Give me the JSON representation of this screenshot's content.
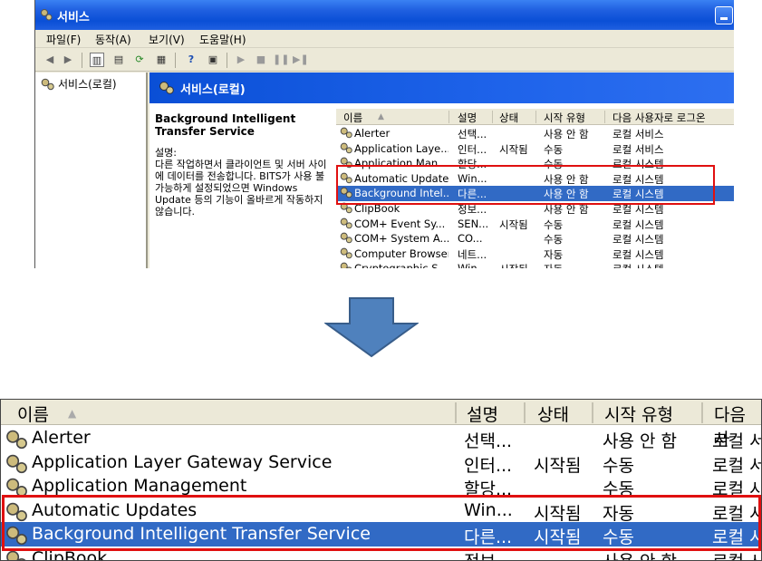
{
  "window": {
    "title": "서비스"
  },
  "menu": [
    "파일(F)",
    "동작(A)",
    "보기(V)",
    "도움말(H)"
  ],
  "tree": {
    "root_label": "서비스(로컬)"
  },
  "banner": {
    "title": "서비스(로컬)"
  },
  "description": {
    "service_name": "Background Intelligent Transfer Service",
    "label": "설명:",
    "text": "다른 작업하면서 클라이언트 및 서버 사이에 데이터를 전송합니다. BITS가 사용 불가능하게 설정되었으면 Windows Update 등의 기능이 올바르게 작동하지 않습니다."
  },
  "list": {
    "columns": [
      "이름",
      "설명",
      "상태",
      "시작 유형",
      "다음 사용자로 로그온"
    ],
    "rows": [
      {
        "name": "Alerter",
        "desc": "선택...",
        "status": "",
        "startup": "사용 안 함",
        "logon": "로컬 서비스"
      },
      {
        "name": "Application Laye...",
        "desc": "인터...",
        "status": "시작됨",
        "startup": "수동",
        "logon": "로컬 서비스"
      },
      {
        "name": "Application Man...",
        "desc": "할당...",
        "status": "",
        "startup": "수동",
        "logon": "로컬 시스템"
      },
      {
        "name": "Automatic Updates",
        "desc": "Win...",
        "status": "",
        "startup": "사용 안 함",
        "logon": "로컬 시스템"
      },
      {
        "name": "Background Intel...",
        "desc": "다른...",
        "status": "",
        "startup": "사용 안 함",
        "logon": "로컬 시스템"
      },
      {
        "name": "ClipBook",
        "desc": "정보...",
        "status": "",
        "startup": "사용 안 함",
        "logon": "로컬 시스템"
      },
      {
        "name": "COM+ Event Sy...",
        "desc": "SEN...",
        "status": "시작됨",
        "startup": "수동",
        "logon": "로컬 시스템"
      },
      {
        "name": "COM+ System A...",
        "desc": "CO...",
        "status": "",
        "startup": "수동",
        "logon": "로컬 시스템"
      },
      {
        "name": "Computer Browser",
        "desc": "네트...",
        "status": "",
        "startup": "자동",
        "logon": "로컬 시스템"
      },
      {
        "name": "Cryptographic S...",
        "desc": "Win...",
        "status": "시작됨",
        "startup": "자동",
        "logon": "로컬 시스템"
      }
    ]
  },
  "zoom": {
    "columns": [
      "이름",
      "설명",
      "상태",
      "시작 유형",
      "다음 사"
    ],
    "rows": [
      {
        "name": "Alerter",
        "desc": "선택...",
        "status": "",
        "startup": "사용 안 함",
        "logon": "로컬 서"
      },
      {
        "name": "Application Layer Gateway Service",
        "desc": "인터...",
        "status": "시작됨",
        "startup": "수동",
        "logon": "로컬 서"
      },
      {
        "name": "Application Management",
        "desc": "할당...",
        "status": "",
        "startup": "수동",
        "logon": "로컬 시"
      },
      {
        "name": "Automatic Updates",
        "desc": "Win...",
        "status": "시작됨",
        "startup": "자동",
        "logon": "로컬 시"
      },
      {
        "name": "Background Intelligent Transfer Service",
        "desc": "다른...",
        "status": "시작됨",
        "startup": "수동",
        "logon": "로컬 시"
      },
      {
        "name": "ClipBook",
        "desc": "정보...",
        "status": "",
        "startup": "사용 안 함",
        "logon": "로컬 시"
      }
    ]
  },
  "colors": {
    "selection": "#316ac5",
    "highlight_box": "#e01010",
    "arrow": "#4f81bd"
  }
}
